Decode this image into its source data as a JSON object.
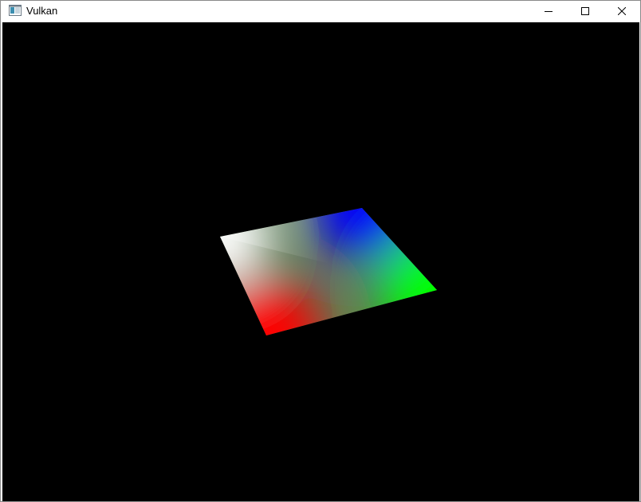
{
  "window": {
    "title": "Vulkan",
    "icons": {
      "app": "window-app-icon",
      "minimize": "minimize-icon",
      "maximize": "maximize-icon",
      "close": "close-icon"
    }
  },
  "render": {
    "background_color": "#000000",
    "quad": {
      "corner_colors": {
        "top_left": "#ffffff",
        "top_right": "#0000ff",
        "bottom_right": "#00ff00",
        "bottom_left": "#ff0000"
      }
    }
  }
}
